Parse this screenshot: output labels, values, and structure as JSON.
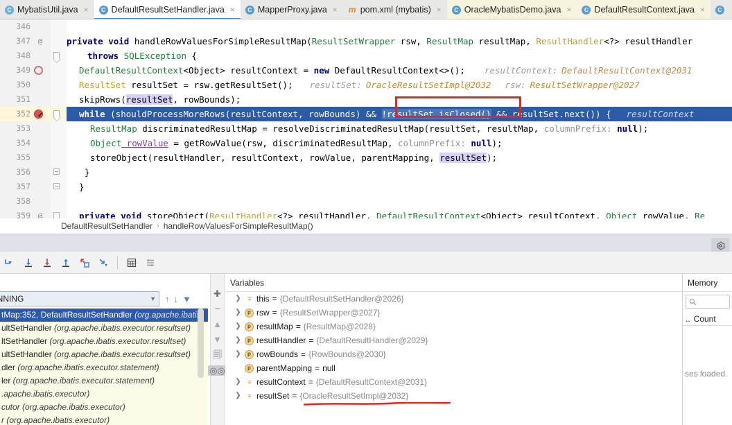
{
  "tabs": [
    {
      "label": "MybatisUtil.java",
      "icon": "java-class-icon",
      "state": "normal"
    },
    {
      "label": "DefaultResultSetHandler.java",
      "icon": "java-class-icon",
      "state": "selected"
    },
    {
      "label": "MapperProxy.java",
      "icon": "java-class-icon",
      "state": "normal"
    },
    {
      "label": "pom.xml (mybatis)",
      "icon": "maven-xml-icon",
      "state": "normal"
    },
    {
      "label": "OracleMybatisDemo.java",
      "icon": "java-class-icon",
      "state": "warning"
    },
    {
      "label": "DefaultResultContext.java",
      "icon": "java-class-icon",
      "state": "warning"
    }
  ],
  "editor": {
    "lines": [
      {
        "no": "346",
        "gmark": "",
        "fold": "",
        "bp": ""
      },
      {
        "no": "347",
        "gmark": "@",
        "fold": "",
        "bp": ""
      },
      {
        "no": "348",
        "gmark": "",
        "fold": "arrow",
        "bp": ""
      },
      {
        "no": "349",
        "gmark": "",
        "fold": "",
        "bp": "hollow"
      },
      {
        "no": "350",
        "gmark": "",
        "fold": "",
        "bp": ""
      },
      {
        "no": "351",
        "gmark": "",
        "fold": "",
        "bp": ""
      },
      {
        "no": "352",
        "gmark": "",
        "fold": "arrow",
        "bp": "solid"
      },
      {
        "no": "353",
        "gmark": "",
        "fold": "",
        "bp": ""
      },
      {
        "no": "354",
        "gmark": "",
        "fold": "",
        "bp": ""
      },
      {
        "no": "355",
        "gmark": "",
        "fold": "",
        "bp": ""
      },
      {
        "no": "356",
        "gmark": "",
        "fold": "box",
        "bp": ""
      },
      {
        "no": "357",
        "gmark": "",
        "fold": "box",
        "bp": ""
      },
      {
        "no": "358",
        "gmark": "",
        "fold": "",
        "bp": ""
      },
      {
        "no": "359",
        "gmark": "@",
        "fold": "arrow",
        "bp": ""
      }
    ],
    "code": {
      "l347_a": "private void ",
      "l347_b": "handleRowValuesForSimpleResultMap(",
      "l347_c": "ResultSetWrapper",
      "l347_d": " rsw, ",
      "l347_e": "ResultMap",
      "l347_f": " resultMap, ",
      "l347_g": "ResultHandler",
      "l347_h": "<?> resultHandler",
      "l348_a": "throws ",
      "l348_b": "SQLException",
      "l348_c": " {",
      "l349_a": "DefaultResultContext",
      "l349_b": "<Object> resultContext = ",
      "l349_c": "new ",
      "l349_d": "DefaultResultContext<>();",
      "l349_hint": "resultContext:",
      "l349_hintv": "DefaultResultContext@2031",
      "l350_a": "ResultSet",
      "l350_b": " resultSet = rsw.getResultSet();",
      "l350_hint1": "resultSet:",
      "l350_hintv1": "OracleResultSetImpl@2032",
      "l350_hint2": "rsw:",
      "l350_hintv2": "ResultSetWrapper@2027",
      "l351_a": "skipRows(",
      "l351_b": "resultSet",
      "l351_c": ", rowBounds);",
      "l352_a": "while ",
      "l352_b": "(shouldProcessMoreRows(resultContext, rowBounds) && ",
      "l352_c": "!resultSet.isClosed()",
      "l352_d": " && resultSet.next()) {",
      "l352_hint": "resultContext",
      "l353_a": "ResultMap",
      "l353_b": " discriminatedResultMap = resolveDiscriminatedResultMap(resultSet, resultMap, ",
      "l353_c": "columnPrefix:",
      "l353_d": " null",
      "l353_e": ");",
      "l354_a": "Object",
      "l354_b": " rowValue",
      "l354_c": " = getRowValue(rsw, discriminatedResultMap, ",
      "l354_d": "columnPrefix:",
      "l354_e": " null",
      "l354_f": ");",
      "l355_a": "storeObject(resultHandler, resultContext, rowValue, parentMapping, ",
      "l355_b": "resultSet",
      "l355_c": ");",
      "l356": "}",
      "l357": "}",
      "l359_a": "private void ",
      "l359_b": "storeObject(",
      "l359_c": "ResultHandler",
      "l359_d": "<?> resultHandler, ",
      "l359_e": "DefaultResultContext",
      "l359_f": "<Object> resultContext, ",
      "l359_g": "Object",
      "l359_h": " rowValue, ",
      "l359_i": "Re"
    },
    "annotation_color": "#e8241c"
  },
  "breadcrumb": {
    "class": "DefaultResultSetHandler",
    "separator": "›",
    "method": "handleRowValuesForSimpleResultMap()"
  },
  "debug_toolbar": {
    "buttons": [
      {
        "name": "show-execution-point-icon",
        "glyph": "↳"
      },
      {
        "name": "step-over-icon",
        "glyph": "⤓"
      },
      {
        "name": "step-into-icon",
        "glyph": "⤓"
      },
      {
        "name": "step-out-icon",
        "glyph": "⤒"
      },
      {
        "name": "force-step-into-icon",
        "glyph": "⤵"
      },
      {
        "name": "run-to-cursor-icon",
        "glyph": "⤓"
      },
      {
        "name": "evaluate-expression-icon",
        "glyph": "▦"
      },
      {
        "name": "layout-settings-icon",
        "glyph": "⋮≡"
      }
    ],
    "settings_icon": "gear-icon"
  },
  "frames": {
    "thread_label": "UNNING",
    "tool_icons": [
      "arrow-up-icon",
      "arrow-down-icon",
      "filter-icon"
    ],
    "stack": [
      {
        "method": "tMap:352, DefaultResultSetHandler ",
        "pkg": "(org.apache.ibatis.",
        "selected": true
      },
      {
        "method": "ultSetHandler ",
        "pkg": "(org.apache.ibatis.executor.resultset)",
        "selected": false
      },
      {
        "method": "ltSetHandler ",
        "pkg": "(org.apache.ibatis.executor.resultset)",
        "selected": false
      },
      {
        "method": "ultSetHandler ",
        "pkg": "(org.apache.ibatis.executor.resultset)",
        "selected": false
      },
      {
        "method": "dler ",
        "pkg": "(org.apache.ibatis.executor.statement)",
        "selected": false
      },
      {
        "method": "ler ",
        "pkg": "(org.apache.ibatis.executor.statement)",
        "selected": false
      },
      {
        "method": "",
        "pkg": ".apache.ibatis.executor)",
        "selected": false
      },
      {
        "method": "",
        "pkg": "cutor (org.apache.ibatis.executor)",
        "selected": false
      },
      {
        "method": "",
        "pkg": "r (org.apache.ibatis.executor)",
        "selected": false
      }
    ]
  },
  "variables": {
    "title": "Variables",
    "tool_icons": [
      "add-icon",
      "remove-icon",
      "move-up-icon",
      "move-down-icon",
      "copy-icon",
      "watches-icon"
    ],
    "rows": [
      {
        "expandable": true,
        "kind": "field",
        "name": "this",
        "value": "{DefaultResultSetHandler@2026}"
      },
      {
        "expandable": true,
        "kind": "param",
        "name": "rsw",
        "value": "{ResultSetWrapper@2027}"
      },
      {
        "expandable": true,
        "kind": "param",
        "name": "resultMap",
        "value": "{ResultMap@2028}"
      },
      {
        "expandable": true,
        "kind": "param",
        "name": "resultHandler",
        "value": "{DefaultResultHandler@2029}"
      },
      {
        "expandable": true,
        "kind": "param",
        "name": "rowBounds",
        "value": "{RowBounds@2030}"
      },
      {
        "expandable": false,
        "kind": "param",
        "name": "parentMapping",
        "value": "null"
      },
      {
        "expandable": true,
        "kind": "field",
        "name": "resultContext",
        "value": "{DefaultResultContext@2031}"
      },
      {
        "expandable": true,
        "kind": "field",
        "name": "resultSet",
        "value": "{OracleResultSetImpl@2032}"
      }
    ],
    "equals": "="
  },
  "memory": {
    "title": "Memory",
    "search_placeholder": "",
    "search_icon": "search-icon",
    "column_ellipsis": "..",
    "column_count": "Count",
    "note": "ses loaded."
  }
}
